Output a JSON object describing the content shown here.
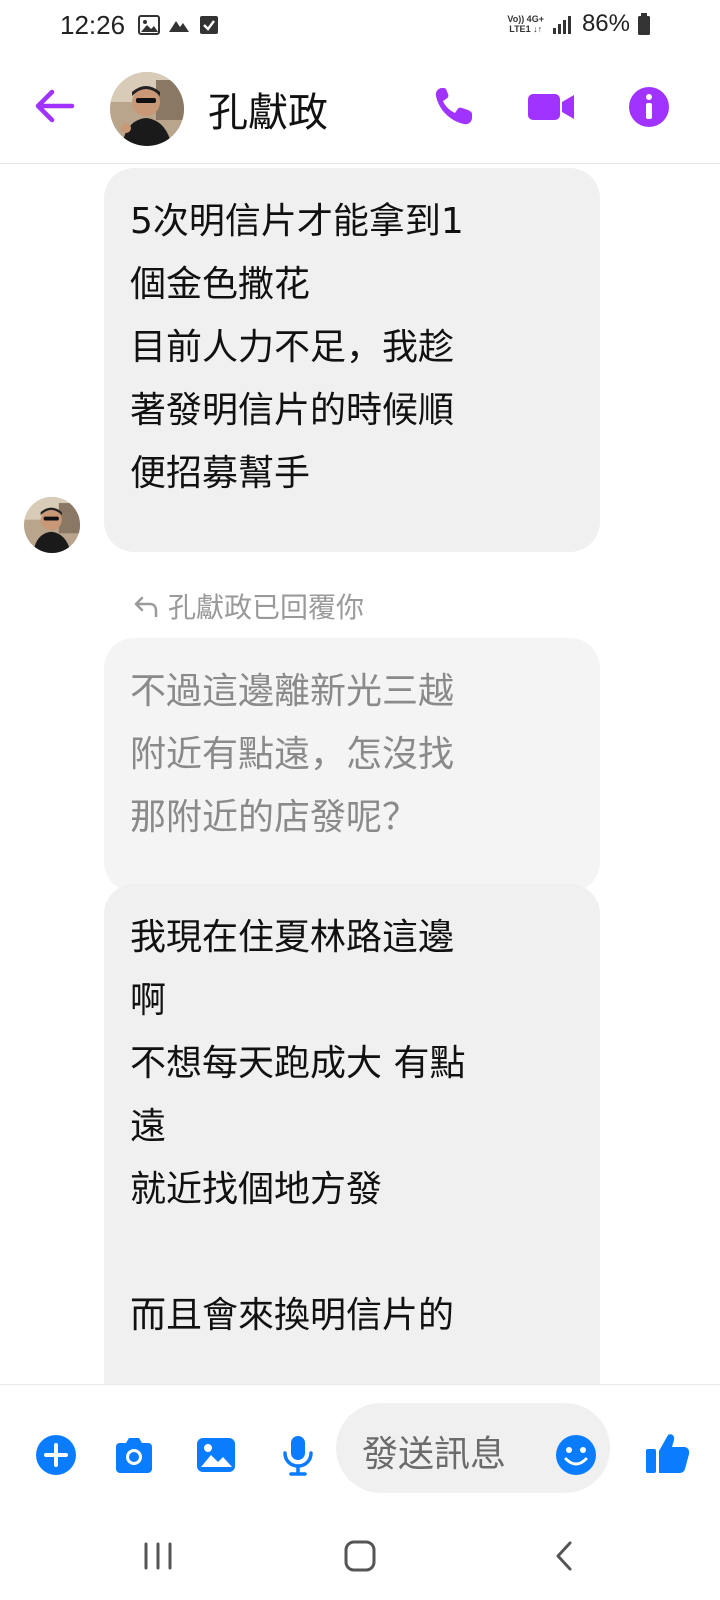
{
  "status_bar": {
    "time": "12:26",
    "network_top": "Vo)) 4G+",
    "network_bottom": "LTE1 ↓↑",
    "battery": "86%"
  },
  "header": {
    "contact_name": "孔獻政",
    "accent_color": "#a033ff"
  },
  "messages": [
    {
      "text": "5次明信片才能拿到1\n個金色撒花\n目前人力不足，我趁\n著發明信片的時候順\n便招募幫手"
    },
    {
      "text": "不過這邊離新光三越\n附近有點遠，怎沒找\n那附近的店發呢？"
    },
    {
      "text": "我現在住夏林路這邊\n啊\n不想每天跑成大 有點\n遠\n就近找個地方發\n\n而且會來換明信片的"
    }
  ],
  "reply_note": "孔獻政已回覆你",
  "composer": {
    "placeholder": "發送訊息",
    "accent_color": "#0a7cff"
  },
  "icons": {
    "back": "arrow-left-icon",
    "call": "phone-icon",
    "video": "video-camera-icon",
    "info": "info-icon",
    "plus": "plus-icon",
    "camera": "camera-icon",
    "gallery": "image-icon",
    "mic": "microphone-icon",
    "emoji": "emoji-icon",
    "like": "thumbs-up-icon"
  }
}
